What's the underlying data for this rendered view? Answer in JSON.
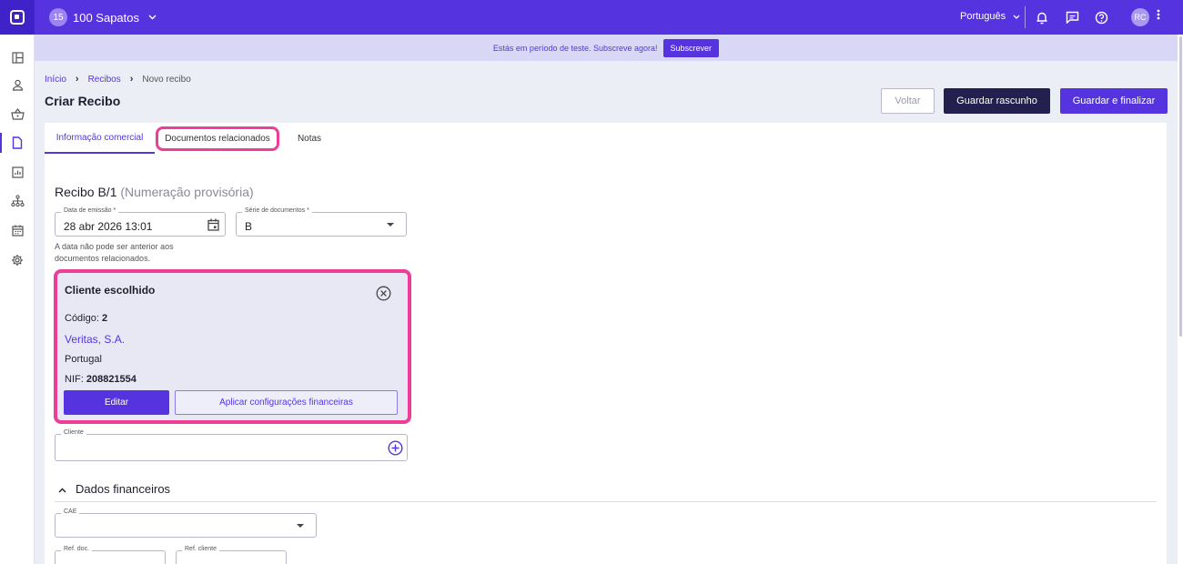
{
  "topbar": {
    "company_badge": "15",
    "company_name": "100 Sapatos",
    "language": "Português",
    "avatar_initials": "RC",
    "icons": [
      "app-logo-icon",
      "bell-icon",
      "message-icon",
      "help-icon",
      "more-vert-icon"
    ]
  },
  "sidebar": {
    "items": [
      "dashboard-icon",
      "contacts-icon",
      "sales-basket-icon",
      "documents-icon",
      "reports-icon",
      "structure-icon",
      "calendar-icon",
      "settings-icon"
    ],
    "active": "documents-icon",
    "footer_icon": "rocket-icon"
  },
  "banner": {
    "text": "Estás em período de teste. Subscreve agora!",
    "button": "Subscrever"
  },
  "breadcrumb": {
    "home": "Início",
    "section": "Recibos",
    "current": "Novo recibo"
  },
  "page": {
    "title": "Criar Recibo",
    "btn_back": "Voltar",
    "btn_draft": "Guardar rascunho",
    "btn_finalize": "Guardar e finalizar"
  },
  "tabs": {
    "info": "Informação comercial",
    "docs": "Documentos relacionados",
    "notes": "Notas"
  },
  "receipt": {
    "number": "Recibo B/1",
    "provisional": "(Numeração provisória)",
    "date_label": "Data de emissão *",
    "date_value": "28 abr 2026 13:01",
    "series_label": "Série de documentos *",
    "series_value": "B",
    "date_hint": "A data não pode ser anterior aos documentos relacionados."
  },
  "client": {
    "title": "Cliente escolhido",
    "code_label": "Código:",
    "code_value": "2",
    "name": "Veritas, S.A.",
    "country": "Portugal",
    "nif_label": "NIF:",
    "nif_value": "208821554",
    "btn_edit": "Editar",
    "btn_apply": "Aplicar configurações financeiras",
    "field_label": "Cliente",
    "field_value": ""
  },
  "financial": {
    "section_title": "Dados financeiros",
    "cae_label": "CAE",
    "cae_value": "",
    "ref_doc_label": "Ref. doc.",
    "ref_client_label": "Ref. cliente"
  },
  "colors": {
    "brand": "#5534e0",
    "dark_button": "#23204f",
    "highlight": "#ec3d99"
  }
}
